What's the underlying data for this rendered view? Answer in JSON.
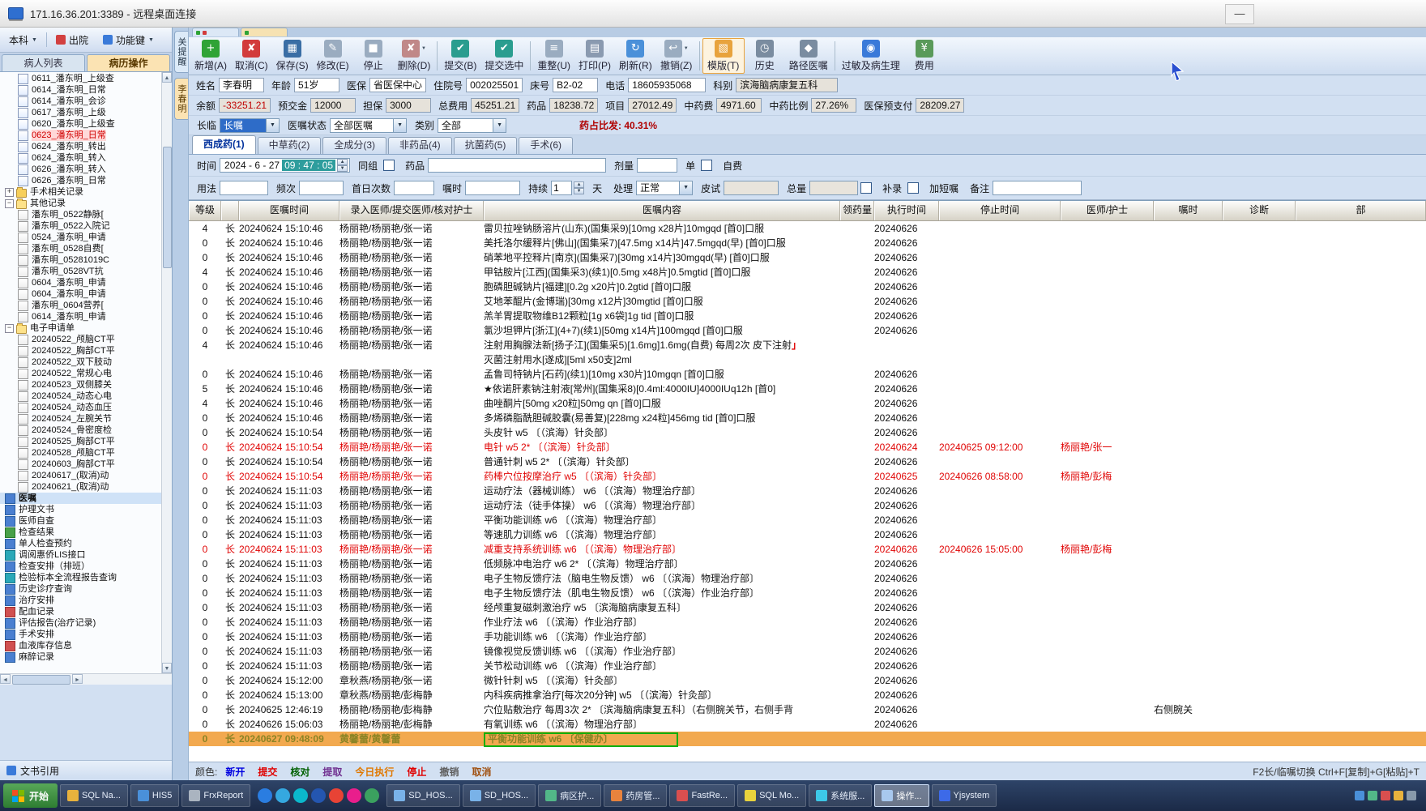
{
  "window": {
    "title": "171.16.36.201:3389 - 远程桌面连接",
    "minimize_label": "—"
  },
  "left_toolbar": {
    "dept_label": "本科",
    "discharge_label": "出院",
    "fnkeys_label": "功能键"
  },
  "sidebar": {
    "tabs": [
      {
        "label": "病人列表",
        "active": false
      },
      {
        "label": "病历操作",
        "active": true
      }
    ],
    "tree": [
      {
        "label": "0611_潘东明_上级查",
        "kind": "doc",
        "level": 2
      },
      {
        "label": "0614_潘东明_日常",
        "kind": "doc",
        "level": 2
      },
      {
        "label": "0614_潘东明_会诊",
        "kind": "doc",
        "level": 2
      },
      {
        "label": "0617_潘东明_上级",
        "kind": "doc",
        "level": 2
      },
      {
        "label": "0620_潘东明_上级查",
        "kind": "doc",
        "level": 2
      },
      {
        "label": "0623_潘东明_日常",
        "kind": "doc",
        "level": 2,
        "state": "selected-red"
      },
      {
        "label": "0624_潘东明_转出",
        "kind": "doc",
        "level": 2
      },
      {
        "label": "0624_潘东明_转入",
        "kind": "doc",
        "level": 2
      },
      {
        "label": "0626_潘东明_转入",
        "kind": "doc",
        "level": 2
      },
      {
        "label": "0626_潘东明_日常",
        "kind": "doc",
        "level": 2
      },
      {
        "label": "手术相关记录",
        "kind": "folder",
        "level": 1,
        "expander": "+"
      },
      {
        "label": "其他记录",
        "kind": "folder-open",
        "level": 1,
        "expander": "-"
      },
      {
        "label": "潘东明_0522静脉[",
        "kind": "doc2",
        "level": 2
      },
      {
        "label": "潘东明_0522入院记",
        "kind": "doc2",
        "level": 2
      },
      {
        "label": "0524_潘东明_申请",
        "kind": "doc2",
        "level": 2
      },
      {
        "label": "潘东明_0528自费[",
        "kind": "doc2",
        "level": 2
      },
      {
        "label": "潘东明_05281019C",
        "kind": "doc2",
        "level": 2
      },
      {
        "label": "潘东明_0528VT抗",
        "kind": "doc2",
        "level": 2
      },
      {
        "label": "0604_潘东明_申请",
        "kind": "doc2",
        "level": 2
      },
      {
        "label": "0604_潘东明_申请",
        "kind": "doc2",
        "level": 2
      },
      {
        "label": "潘东明_0604营养[",
        "kind": "doc2",
        "level": 2
      },
      {
        "label": "0614_潘东明_申请",
        "kind": "doc2",
        "level": 2
      },
      {
        "label": "电子申请单",
        "kind": "folder-open",
        "level": 1,
        "expander": "-"
      },
      {
        "label": "20240522_颅脑CT平",
        "kind": "doc2",
        "level": 2
      },
      {
        "label": "20240522_胸部CT平",
        "kind": "doc2",
        "level": 2
      },
      {
        "label": "20240522_双下肢动",
        "kind": "doc2",
        "level": 2
      },
      {
        "label": "20240522_常规心电",
        "kind": "doc2",
        "level": 2
      },
      {
        "label": "20240523_双侧膝关",
        "kind": "doc2",
        "level": 2
      },
      {
        "label": "20240524_动态心电",
        "kind": "doc2",
        "level": 2
      },
      {
        "label": "20240524_动态血压",
        "kind": "doc2",
        "level": 2
      },
      {
        "label": "20240524_左腕关节",
        "kind": "doc2",
        "level": 2
      },
      {
        "label": "20240524_骨密度检",
        "kind": "doc2",
        "level": 2
      },
      {
        "label": "20240525_胸部CT平",
        "kind": "doc2",
        "level": 2
      },
      {
        "label": "20240528_颅脑CT平",
        "kind": "doc2",
        "level": 2
      },
      {
        "label": "20240603_胸部CT平",
        "kind": "doc2",
        "level": 2
      },
      {
        "label": "20240617_(取消)动",
        "kind": "doc2",
        "level": 2
      },
      {
        "label": "20240621_(取消)动",
        "kind": "doc2",
        "level": 2
      },
      {
        "label": "医嘱",
        "kind": "item-blue",
        "level": 1,
        "state": "selected"
      },
      {
        "label": "护理文书",
        "kind": "item-blue",
        "level": 1
      },
      {
        "label": "医师自查",
        "kind": "item-blue",
        "level": 1
      },
      {
        "label": "检查结果",
        "kind": "item-green",
        "level": 1
      },
      {
        "label": "单人检查预约",
        "kind": "item-blue",
        "level": 1
      },
      {
        "label": "调阅惠侨LIS接口",
        "kind": "item-teal",
        "level": 1
      },
      {
        "label": "检查安排（排班）",
        "kind": "item-blue",
        "level": 1
      },
      {
        "label": "检验标本全流程报告查询",
        "kind": "item-teal",
        "level": 1
      },
      {
        "label": "历史诊疗查询",
        "kind": "item-blue",
        "level": 1
      },
      {
        "label": "治疗安排",
        "kind": "item-blue",
        "level": 1
      },
      {
        "label": "配血记录",
        "kind": "item-red",
        "level": 1
      },
      {
        "label": "评估报告(治疗记录)",
        "kind": "item-blue",
        "level": 1
      },
      {
        "label": "手术安排",
        "kind": "item-blue",
        "level": 1
      },
      {
        "label": "血液库存信息",
        "kind": "item-red",
        "level": 1
      },
      {
        "label": "麻醉记录",
        "kind": "item-blue",
        "level": 1
      }
    ],
    "footer_label": "文书引用"
  },
  "vertical_tabs": [
    {
      "label": "关提醒",
      "active": false
    },
    {
      "label": "李春明",
      "active": true
    }
  ],
  "icons": {
    "add": "+",
    "cancel": "✘",
    "save": "▦",
    "edit": "✎",
    "stop": "■",
    "delete": "✘",
    "submit": "✔",
    "submit2": "✔",
    "rearrange": "≡",
    "print": "▤",
    "refresh": "↻",
    "undo": "↩",
    "template": "▧",
    "history": "◷",
    "path": "◆",
    "allergy": "◉",
    "fee": "¥"
  },
  "toolbar": {
    "buttons": [
      {
        "name": "add",
        "label": "新增(A)"
      },
      {
        "name": "cancel",
        "label": "取消(C)"
      },
      {
        "name": "save",
        "label": "保存(S)"
      },
      {
        "name": "edit",
        "label": "修改(E)"
      },
      {
        "name": "stop",
        "label": "停止"
      },
      {
        "name": "delete",
        "label": "删除(D)",
        "dropdown": true,
        "sep": true
      },
      {
        "name": "submit",
        "label": "提交(B)"
      },
      {
        "name": "submit2",
        "label": "提交选中",
        "sep": true
      },
      {
        "name": "rearrange",
        "label": "重整(U)"
      },
      {
        "name": "print",
        "label": "打印(P)"
      },
      {
        "name": "refresh",
        "label": "刷新(R)"
      },
      {
        "name": "undo",
        "label": "撤销(Z)",
        "dropdown": true,
        "sep": true
      },
      {
        "name": "template",
        "label": "模版(T)",
        "boxed": true
      },
      {
        "name": "history",
        "label": "历史"
      },
      {
        "name": "path",
        "label": "路径医嘱",
        "sep": true
      },
      {
        "name": "allergy",
        "label": "过敏及病生理"
      },
      {
        "name": "fee",
        "label": "费用"
      }
    ]
  },
  "patient": {
    "row1": [
      {
        "key": "name",
        "label": "姓名",
        "value": "李春明"
      },
      {
        "key": "age",
        "label": "年龄",
        "value": "51岁"
      },
      {
        "key": "insurance",
        "label": "医保",
        "value": "省医保中心"
      },
      {
        "key": "admission_no",
        "label": "住院号",
        "value": "002025501"
      },
      {
        "key": "bed_no",
        "label": "床号",
        "value": "B2-02"
      },
      {
        "key": "phone",
        "label": "电话",
        "value": "18605935068"
      },
      {
        "key": "department",
        "label": "科别",
        "value": "滨海脑病康复五科"
      }
    ],
    "row2": [
      {
        "key": "balance",
        "label": "余额",
        "value": "-33251.21"
      },
      {
        "key": "deposit",
        "label": "预交金",
        "value": "12000"
      },
      {
        "key": "guarantee",
        "label": "担保",
        "value": "3000"
      },
      {
        "key": "total_cost",
        "label": "总费用",
        "value": "45251.21"
      },
      {
        "key": "drug_cost",
        "label": "药品",
        "value": "18238.72"
      },
      {
        "key": "item_cost",
        "label": "项目",
        "value": "27012.49"
      },
      {
        "key": "herb_cost",
        "label": "中药费",
        "value": "4971.60"
      },
      {
        "key": "herb_ratio",
        "label": "中药比例",
        "value": "27.26%"
      },
      {
        "key": "insurance_prepay",
        "label": "医保预支付",
        "value": "28209.27"
      }
    ]
  },
  "filters": {
    "changlin_label": "长临",
    "changlin_value": "长嘱",
    "status_label": "医嘱状态",
    "status_value": "全部医嘱",
    "type_label": "类别",
    "type_value": "全部",
    "ratio_text": "药占比发: 40.31%"
  },
  "order_tabs": [
    {
      "label": "西成药(1)",
      "active": true
    },
    {
      "label": "中草药(2)",
      "active": false
    },
    {
      "label": "全成分(3)",
      "active": false
    },
    {
      "label": "非药品(4)",
      "active": false
    },
    {
      "label": "抗菌药(5)",
      "active": false
    },
    {
      "label": "手术(6)",
      "active": false
    }
  ],
  "entry": {
    "time_label": "时间",
    "time_date": "2024 - 6 - 27",
    "time_time": "09 : 47 : 05",
    "group_label": "同组",
    "drug_label": "药品",
    "dose_label": "剂量",
    "unit_label": "单",
    "selfpay_label": "自费",
    "usage_label": "用法",
    "freq_label": "频次",
    "firstday_label": "首日次数",
    "zhushi_label": "嘱时",
    "duration_label": "持续",
    "duration_value": "1",
    "day_label": "天",
    "process_label": "处理",
    "process_value": "正常",
    "skintest_label": "皮试",
    "total_label": "总量",
    "bulu_label": "补录",
    "jiaduan_label": "加短嘱",
    "note_label": "备注"
  },
  "table": {
    "columns": [
      "等级",
      "",
      "医嘱时间",
      "录入医师/提交医师/核对护士",
      "医嘱内容",
      "领药量",
      "执行时间",
      "停止时间",
      "医师/护士",
      "嘱时",
      "诊断",
      "部"
    ],
    "rows": [
      {
        "grade": "4",
        "type": "长",
        "time": "20240624 15:10:46",
        "doctors": "杨丽艳/杨丽艳/张一诺",
        "content": "雷贝拉唑钠肠溶片(山东)(国集采9)[10mg x28片]10mgqd [首0]口服",
        "exec": "20240626"
      },
      {
        "grade": "0",
        "type": "长",
        "time": "20240624 15:10:46",
        "doctors": "杨丽艳/杨丽艳/张一诺",
        "content": "美托洛尔缓释片[佛山](国集采7)[47.5mg x14片]47.5mgqd(早) [首0]口服",
        "exec": "20240626"
      },
      {
        "grade": "0",
        "type": "长",
        "time": "20240624 15:10:46",
        "doctors": "杨丽艳/杨丽艳/张一诺",
        "content": "硝苯地平控释片[南京](国集采7)[30mg x14片]30mgqd(早) [首0]口服",
        "exec": "20240626"
      },
      {
        "grade": "4",
        "type": "长",
        "time": "20240624 15:10:46",
        "doctors": "杨丽艳/杨丽艳/张一诺",
        "content": "甲钴胺片[江西](国集采3)(续1)[0.5mg x48片]0.5mgtid [首0]口服",
        "exec": "20240626"
      },
      {
        "grade": "0",
        "type": "长",
        "time": "20240624 15:10:46",
        "doctors": "杨丽艳/杨丽艳/张一诺",
        "content": "胞磷胆碱钠片[福建][0.2g x20片]0.2gtid [首0]口服",
        "exec": "20240626"
      },
      {
        "grade": "0",
        "type": "长",
        "time": "20240624 15:10:46",
        "doctors": "杨丽艳/杨丽艳/张一诺",
        "content": "艾地苯醌片(金博瑞)[30mg x12片]30mgtid [首0]口服",
        "exec": "20240626"
      },
      {
        "grade": "0",
        "type": "长",
        "time": "20240624 15:10:46",
        "doctors": "杨丽艳/杨丽艳/张一诺",
        "content": "羔羊胃提取物维B12颗粒[1g x6袋]1g tid [首0]口服",
        "exec": "20240626"
      },
      {
        "grade": "0",
        "type": "长",
        "time": "20240624 15:10:46",
        "doctors": "杨丽艳/杨丽艳/张一诺",
        "content": "氯沙坦钾片[浙江](4+7)(续1)[50mg x14片]100mgqd [首0]口服",
        "exec": "20240626"
      },
      {
        "grade": "4",
        "type": "长",
        "time": "20240624 15:10:46",
        "doctors": "杨丽艳/杨丽艳/张一诺",
        "content": "注射用胸腺法新[扬子江](国集采5)[1.6mg]1.6mg(自费) 每周2次 皮下注射",
        "mark": "」",
        "content2": "灭菌注射用水[遂成][5ml x50支]2ml",
        "exec": ""
      },
      {
        "grade": "0",
        "type": "长",
        "time": "20240624 15:10:46",
        "doctors": "杨丽艳/杨丽艳/张一诺",
        "content": "孟鲁司特钠片[石药](续1)[10mg x30片]10mgqn [首0]口服",
        "exec": "20240626"
      },
      {
        "grade": "5",
        "type": "长",
        "time": "20240624 15:10:46",
        "doctors": "杨丽艳/杨丽艳/张一诺",
        "content": "★依诺肝素钠注射液[常州](国集采8)[0.4ml:4000IU]4000IUq12h [首0]",
        "exec": "20240626"
      },
      {
        "grade": "4",
        "type": "长",
        "time": "20240624 15:10:46",
        "doctors": "杨丽艳/杨丽艳/张一诺",
        "content": "曲唑酮片[50mg x20粒]50mg qn [首0]口服",
        "exec": "20240626"
      },
      {
        "grade": "0",
        "type": "长",
        "time": "20240624 15:10:46",
        "doctors": "杨丽艳/杨丽艳/张一诺",
        "content": "多烯磷脂酰胆碱胶囊(易善复)[228mg x24粒]456mg tid [首0]口服",
        "exec": "20240626"
      },
      {
        "grade": "0",
        "type": "长",
        "time": "20240624 15:10:54",
        "doctors": "杨丽艳/杨丽艳/张一诺",
        "content": "头皮针 w5 〔（滨海）针灸部〕",
        "exec": "20240626"
      },
      {
        "grade": "0",
        "type": "长",
        "time": "20240624 15:10:54",
        "doctors": "杨丽艳/杨丽艳/张一诺",
        "content": "电针 w5 2* 〔（滨海）针灸部〕",
        "exec": "20240624",
        "stop": "20240625 09:12:00",
        "nurse": "杨丽艳/张一",
        "status": "stopped"
      },
      {
        "grade": "0",
        "type": "长",
        "time": "20240624 15:10:54",
        "doctors": "杨丽艳/杨丽艳/张一诺",
        "content": "普通针刺 w5 2* 〔（滨海）针灸部〕",
        "exec": "20240626"
      },
      {
        "grade": "0",
        "type": "长",
        "time": "20240624 15:10:54",
        "doctors": "杨丽艳/杨丽艳/张一诺",
        "content": "药棒穴位按摩治疗 w5 〔（滨海）针灸部〕",
        "exec": "20240625",
        "stop": "20240626 08:58:00",
        "nurse": "杨丽艳/彭梅",
        "status": "stopped"
      },
      {
        "grade": "0",
        "type": "长",
        "time": "20240624 15:11:03",
        "doctors": "杨丽艳/杨丽艳/张一诺",
        "content": "运动疗法（器械训练） w6 〔（滨海）物理治疗部〕",
        "exec": "20240626"
      },
      {
        "grade": "0",
        "type": "长",
        "time": "20240624 15:11:03",
        "doctors": "杨丽艳/杨丽艳/张一诺",
        "content": "运动疗法（徒手体操） w6 〔（滨海）物理治疗部〕",
        "exec": "20240626"
      },
      {
        "grade": "0",
        "type": "长",
        "time": "20240624 15:11:03",
        "doctors": "杨丽艳/杨丽艳/张一诺",
        "content": "平衡功能训练 w6 〔（滨海）物理治疗部〕",
        "exec": "20240626"
      },
      {
        "grade": "0",
        "type": "长",
        "time": "20240624 15:11:03",
        "doctors": "杨丽艳/杨丽艳/张一诺",
        "content": "等速肌力训练 w6 〔（滨海）物理治疗部〕",
        "exec": "20240626"
      },
      {
        "grade": "0",
        "type": "长",
        "time": "20240624 15:11:03",
        "doctors": "杨丽艳/杨丽艳/张一诺",
        "content": "减重支持系统训练 w6 〔（滨海）物理治疗部〕",
        "exec": "20240626",
        "stop": "20240626 15:05:00",
        "nurse": "杨丽艳/彭梅",
        "status": "stopped"
      },
      {
        "grade": "0",
        "type": "长",
        "time": "20240624 15:11:03",
        "doctors": "杨丽艳/杨丽艳/张一诺",
        "content": "低频脉冲电治疗 w6 2* 〔（滨海）物理治疗部〕",
        "exec": "20240626"
      },
      {
        "grade": "0",
        "type": "长",
        "time": "20240624 15:11:03",
        "doctors": "杨丽艳/杨丽艳/张一诺",
        "content": "电子生物反馈疗法（脑电生物反馈） w6 〔（滨海）物理治疗部〕",
        "exec": "20240626"
      },
      {
        "grade": "0",
        "type": "长",
        "time": "20240624 15:11:03",
        "doctors": "杨丽艳/杨丽艳/张一诺",
        "content": "电子生物反馈疗法（肌电生物反馈） w6 〔（滨海）作业治疗部〕",
        "exec": "20240626"
      },
      {
        "grade": "0",
        "type": "长",
        "time": "20240624 15:11:03",
        "doctors": "杨丽艳/杨丽艳/张一诺",
        "content": "经颅重复磁刺激治疗 w5 〔滨海脑病康复五科〕",
        "exec": "20240626"
      },
      {
        "grade": "0",
        "type": "长",
        "time": "20240624 15:11:03",
        "doctors": "杨丽艳/杨丽艳/张一诺",
        "content": "作业疗法 w6 〔（滨海）作业治疗部〕",
        "exec": "20240626"
      },
      {
        "grade": "0",
        "type": "长",
        "time": "20240624 15:11:03",
        "doctors": "杨丽艳/杨丽艳/张一诺",
        "content": "手功能训练 w6 〔（滨海）作业治疗部〕",
        "exec": "20240626"
      },
      {
        "grade": "0",
        "type": "长",
        "time": "20240624 15:11:03",
        "doctors": "杨丽艳/杨丽艳/张一诺",
        "content": "镜像视觉反馈训练 w6 〔（滨海）作业治疗部〕",
        "exec": "20240626"
      },
      {
        "grade": "0",
        "type": "长",
        "time": "20240624 15:11:03",
        "doctors": "杨丽艳/杨丽艳/张一诺",
        "content": "关节松动训练 w6 〔（滨海）作业治疗部〕",
        "exec": "20240626"
      },
      {
        "grade": "0",
        "type": "长",
        "time": "20240624 15:12:00",
        "doctors": "章秋燕/杨丽艳/张一诺",
        "content": "微针针刺 w5 〔（滨海）针灸部〕",
        "exec": "20240626"
      },
      {
        "grade": "0",
        "type": "长",
        "time": "20240624 15:13:00",
        "doctors": "章秋燕/杨丽艳/彭梅静",
        "content": "内科疾病推拿治疗[每次20分钟] w5 〔（滨海）针灸部〕",
        "exec": "20240626"
      },
      {
        "grade": "0",
        "type": "长",
        "time": "20240625 12:46:19",
        "doctors": "杨丽艳/杨丽艳/彭梅静",
        "content": "穴位贴敷治疗 每周3次 2* 〔滨海脑病康复五科〕（右侧腕关节，右侧手背",
        "exec": "20240626",
        "zhushi": "右侧腕关"
      },
      {
        "grade": "0",
        "type": "长",
        "time": "20240626 15:06:03",
        "doctors": "杨丽艳/杨丽艳/彭梅静",
        "content": "有氧训练 w6 〔（滨海）物理治疗部〕",
        "exec": "20240626"
      },
      {
        "grade": "0",
        "type": "长",
        "time": "20240627 09:48:09",
        "doctors": "黄馨蕾/黄馨蕾",
        "content": "平衡功能训练 w6 〔保健办〕",
        "exec": "",
        "status": "today",
        "highlight": true
      }
    ]
  },
  "legend": {
    "prefix": "颜色:",
    "items": [
      {
        "label": "新开",
        "color": "#0000e0"
      },
      {
        "label": "提交",
        "color": "#e00000"
      },
      {
        "label": "核对",
        "color": "#006000"
      },
      {
        "label": "提取",
        "color": "#703090"
      },
      {
        "label": "今日执行",
        "color": "#e07800"
      },
      {
        "label": "停止",
        "color": "#e00000"
      },
      {
        "label": "撤销",
        "color": "#606060"
      },
      {
        "label": "取消",
        "color": "#a05010"
      }
    ],
    "shortcut": "F2长/临嘱切换 Ctrl+F[复制]+G[粘贴]+T"
  },
  "taskbar": {
    "start_label": "开始",
    "items_left": [
      {
        "label": "SQL Na...",
        "color": "#e8b23d"
      },
      {
        "label": "HIS5",
        "color": "#4a90d9"
      },
      {
        "label": "FrxReport",
        "color": "#aab4c0"
      }
    ],
    "items_right": [
      {
        "label": "SD_HOS...",
        "color": "#79b2e8"
      },
      {
        "label": "SD_HOS...",
        "color": "#79b2e8"
      },
      {
        "label": "病区护...",
        "color": "#52b788"
      },
      {
        "label": "药房管...",
        "color": "#e8833d"
      },
      {
        "label": "FastRe...",
        "color": "#d94f4f"
      },
      {
        "label": "SQL Mo...",
        "color": "#e8d33d"
      },
      {
        "label": "系统服...",
        "color": "#3dc8e8"
      },
      {
        "label": "操作...",
        "color": "#a8c8ee",
        "active": true
      },
      {
        "label": "Yjsystem",
        "color": "#3d6ae8"
      }
    ],
    "quick_launch_colors": [
      "#2a7de1",
      "#35a8e0",
      "#0bb8cc",
      "#2456b0",
      "#e84335",
      "#e91e8c",
      "#3ba15f"
    ],
    "tray_colors": [
      "#4a90d9",
      "#52b788",
      "#d94f4f",
      "#e8b23d",
      "#8899aa"
    ]
  }
}
